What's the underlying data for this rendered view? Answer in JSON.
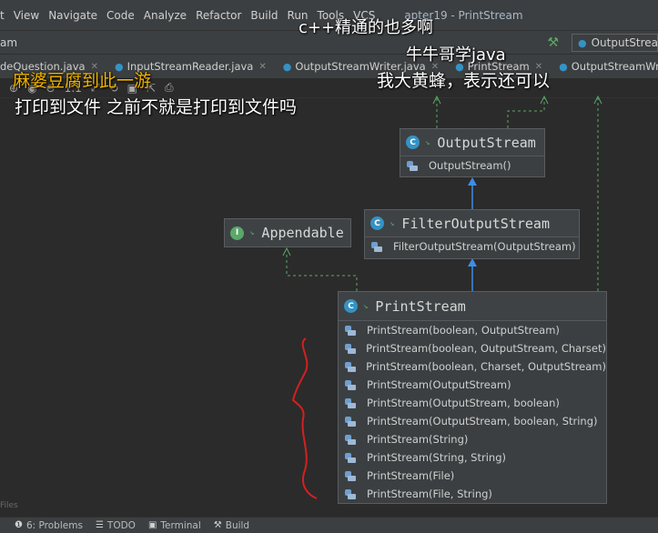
{
  "menubar": {
    "items": [
      "t",
      "View",
      "Navigate",
      "Code",
      "Analyze",
      "Refactor",
      "Build",
      "Run",
      "Tools",
      "VCS"
    ],
    "window_title": "apter19 - PrintStream"
  },
  "navbar": {
    "project": "am",
    "run_config": "OutputStream"
  },
  "tabs": [
    {
      "label": "deQuestion.java",
      "icon": "class-icon"
    },
    {
      "label": "InputStreamReader.java",
      "icon": "class-icon"
    },
    {
      "label": "OutputStreamWriter.java",
      "icon": "class-icon"
    },
    {
      "label": "PrintStream",
      "icon": "class-icon"
    },
    {
      "label": "OutputStreamWriter",
      "icon": "class-icon"
    }
  ],
  "toolbar": {
    "icons": [
      "pin-icon",
      "filter-icon",
      "grid-icon",
      "refresh-icon",
      "zoom-icon",
      "actual-size-icon",
      "fit-icon",
      "layout-icon",
      "save-icon",
      "export-icon",
      "print-icon"
    ],
    "glyphs": [
      "⊕",
      "◉",
      "⊖",
      "1:1",
      "⤢",
      "⟲",
      "▣",
      "⇱",
      "⎙"
    ]
  },
  "diagram": {
    "output_stream": {
      "name": "OutputStream",
      "members": [
        "OutputStream()"
      ]
    },
    "filter_output_stream": {
      "name": "FilterOutputStream",
      "members": [
        "FilterOutputStream(OutputStream)"
      ]
    },
    "appendable": {
      "name": "Appendable"
    },
    "print_stream": {
      "name": "PrintStream",
      "members": [
        "PrintStream(boolean, OutputStream)",
        "PrintStream(boolean, OutputStream, Charset)",
        "PrintStream(boolean, Charset, OutputStream)",
        "PrintStream(OutputStream)",
        "PrintStream(OutputStream, boolean)",
        "PrintStream(OutputStream, boolean, String)",
        "PrintStream(String)",
        "PrintStream(String, String)",
        "PrintStream(File)",
        "PrintStream(File, String)"
      ]
    },
    "colors": {
      "class_badge": "#3592c4",
      "interface_badge": "#59a869",
      "extends_arrow": "#3d8ee6",
      "implements_arrow": "#59a869",
      "annotation_red": "#d42020"
    }
  },
  "subtitles": {
    "line1": "c++精通的也多啊",
    "line2": "牛牛哥学java",
    "line3": "我大黄蜂，表示还可以",
    "line4": "麻婆豆腐到此一游",
    "line5": "打印到文件 之前不就是打印到文件吗"
  },
  "side_label": "Files",
  "statusbar": {
    "problems": "6: Problems",
    "todo": "TODO",
    "terminal": "Terminal",
    "build": "Build"
  }
}
